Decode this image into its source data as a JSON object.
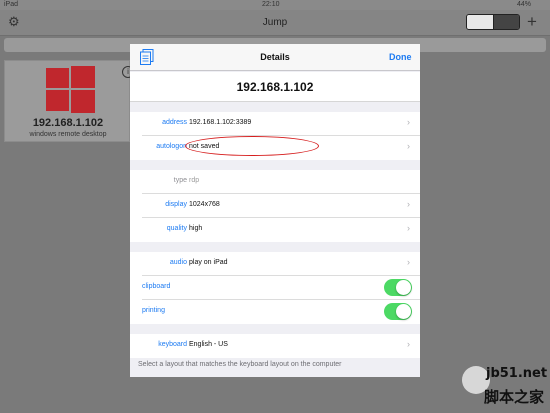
{
  "status": {
    "device": "iPad",
    "time": "22:10",
    "battery": "44%"
  },
  "nav": {
    "title": "Jump",
    "add_symbol": "+"
  },
  "host": {
    "ip": "192.168.1.102",
    "subtitle": "windows remote desktop",
    "info_symbol": "i"
  },
  "modal": {
    "title": "Details",
    "done_label": "Done",
    "host_title": "192.168.1.102",
    "rows": {
      "address": {
        "label": "address",
        "value": "192.168.1.102:3389"
      },
      "autologon": {
        "label": "autologon",
        "value": "not saved"
      },
      "type": {
        "label": "type",
        "value": "rdp"
      },
      "display": {
        "label": "display",
        "value": "1024x768"
      },
      "quality": {
        "label": "quality",
        "value": "high"
      },
      "audio": {
        "label": "audio",
        "value": "play on iPad"
      },
      "clipboard": {
        "label": "clipboard",
        "on": true
      },
      "printing": {
        "label": "printing",
        "on": true
      },
      "keyboard": {
        "label": "keyboard",
        "value": "English - US"
      }
    },
    "footer": "Select a layout that matches the keyboard layout on the computer"
  },
  "watermark": {
    "url": "jb51.net",
    "cn": "脚本之家"
  },
  "colors": {
    "accent": "#1d7bf2",
    "toggle_on": "#4cd964",
    "annotation": "#d61f1f",
    "windows_red": "#c0272d"
  },
  "icons": [
    "gear-icon",
    "list-view-icon",
    "grid-view-icon",
    "plus-icon",
    "windows-logo-icon",
    "info-icon",
    "document-icon",
    "chevron-right-icon"
  ]
}
